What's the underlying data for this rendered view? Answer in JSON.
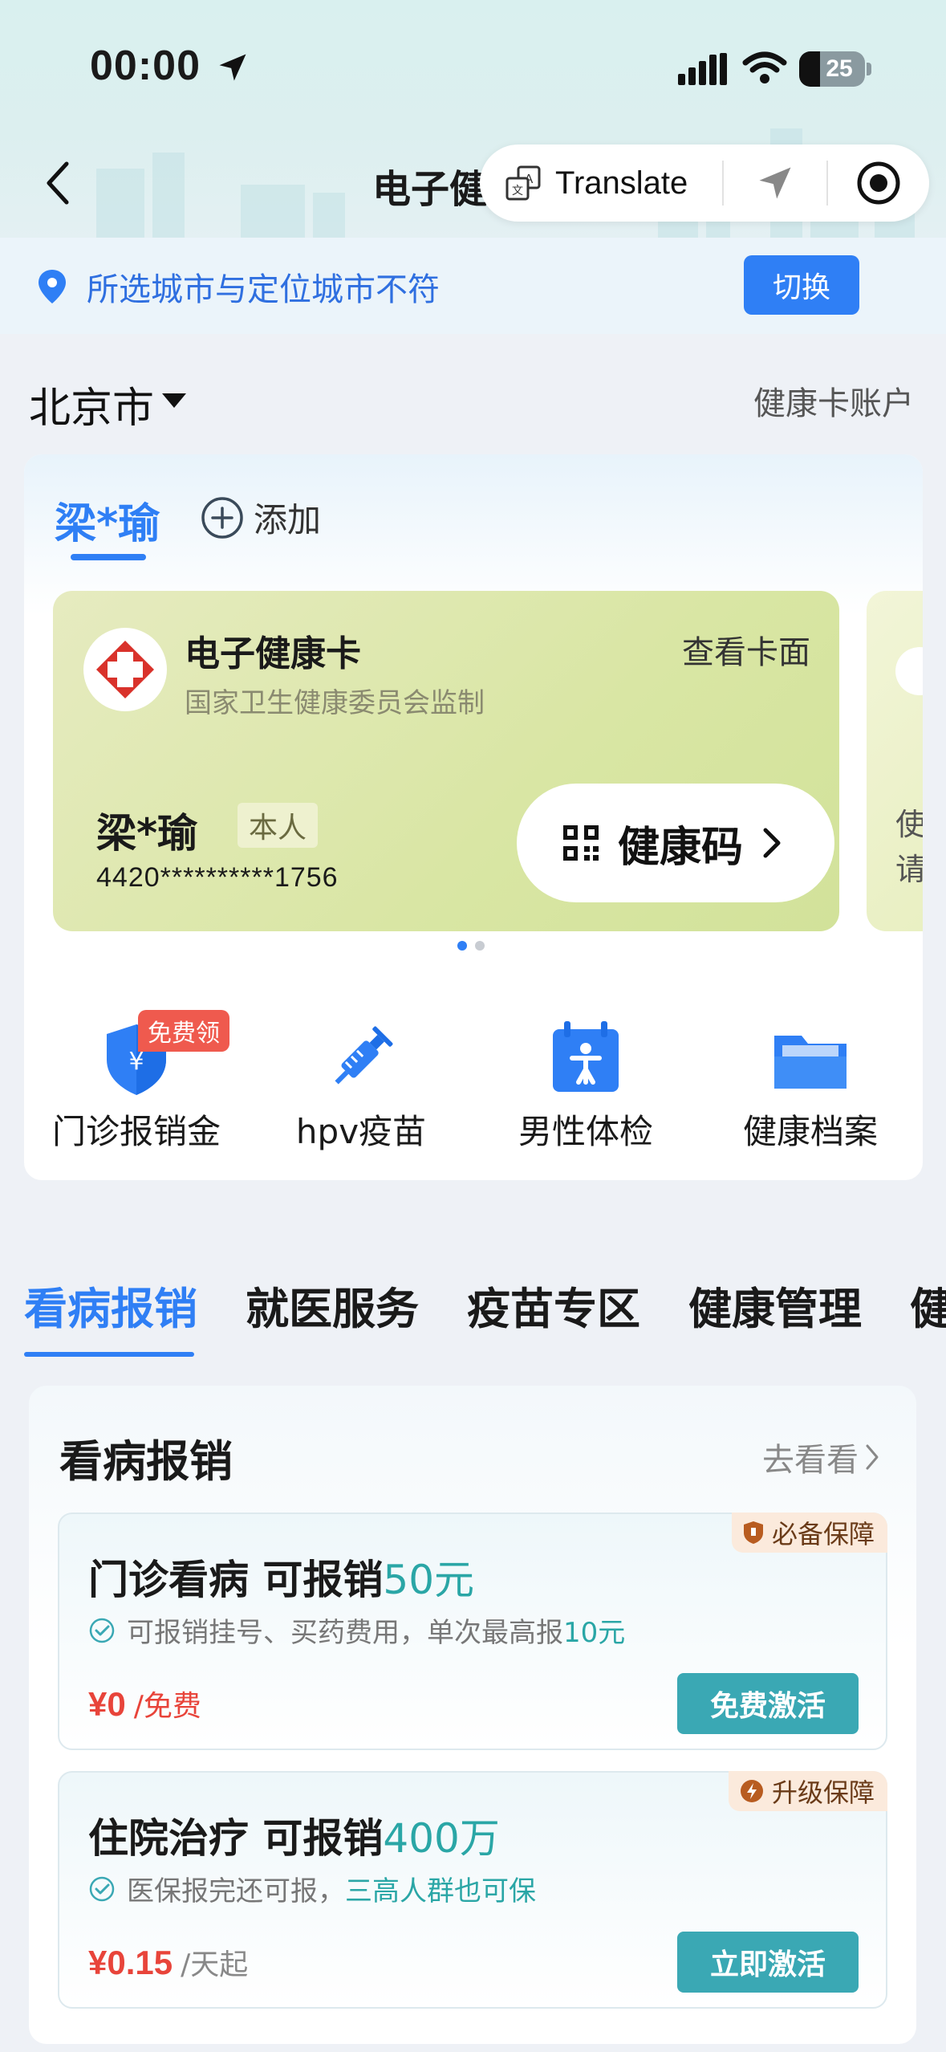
{
  "status_bar": {
    "time": "00:00",
    "battery": "25"
  },
  "nav": {
    "title": "电子健",
    "translate_label": "Translate"
  },
  "city_notice": {
    "message": "所选城市与定位城市不符",
    "switch_label": "切换"
  },
  "city": {
    "name": "北京市",
    "account_link": "健康卡账户"
  },
  "persons": {
    "active": "梁*瑜",
    "add_label": "添加"
  },
  "health_card": {
    "title": "电子健康卡",
    "subtitle": "国家卫生健康委员会监制",
    "view_label": "查看卡面",
    "holder_name": "梁*瑜",
    "relation": "本人",
    "id_number": "4420**********1756",
    "code_button": "健康码",
    "peek_line1": "使",
    "peek_line2": "请"
  },
  "quick_actions": [
    {
      "label": "门诊报销金",
      "icon": "shield-yen-icon",
      "badge": "免费领"
    },
    {
      "label": "hpv疫苗",
      "icon": "syringe-icon"
    },
    {
      "label": "男性体检",
      "icon": "checkup-calendar-icon"
    },
    {
      "label": "健康档案",
      "icon": "folder-icon"
    }
  ],
  "tabs": [
    "看病报销",
    "就医服务",
    "疫苗专区",
    "健康管理",
    "健"
  ],
  "section": {
    "title": "看病报销",
    "more_label": "去看看",
    "offers": [
      {
        "tag": "必备保障",
        "title_prefix": "门诊看病  可报销",
        "title_amount": "50元",
        "desc_prefix": "可报销挂号、买药费用，单次最高报",
        "desc_highlight": "10元",
        "price": "¥0",
        "unit": "/免费",
        "button": "免费激活"
      },
      {
        "tag": "升级保障",
        "title_prefix": "住院治疗  可报销",
        "title_amount": "400万",
        "desc_prefix": "医保报完还可报，",
        "desc_highlight": "三高人群也可保",
        "price": "¥0.15",
        "unit": "/天起",
        "button": "立即激活"
      }
    ]
  },
  "colors": {
    "accent": "#2f7ff5",
    "teal": "#3aa8b4",
    "price_red": "#e8443a",
    "badge_red": "#ef5a4e"
  }
}
